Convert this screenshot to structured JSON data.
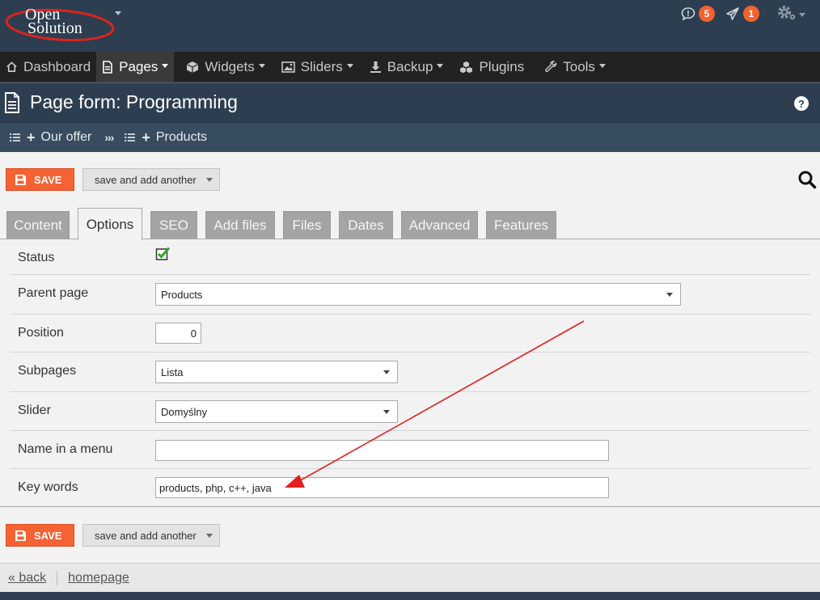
{
  "brand": {
    "logo_line1": "Open",
    "logo_line2": "Solution"
  },
  "header": {
    "messages_count": "5",
    "alerts_count": "1",
    "accent_color": "#f2622e"
  },
  "nav": {
    "items": [
      {
        "label": "Dashboard",
        "icon": "home-icon"
      },
      {
        "label": "Pages",
        "icon": "page-icon"
      },
      {
        "label": "Widgets",
        "icon": "cube-icon"
      },
      {
        "label": "Sliders",
        "icon": "image-icon"
      },
      {
        "label": "Backup",
        "icon": "download-icon"
      },
      {
        "label": "Plugins",
        "icon": "cubes-icon"
      },
      {
        "label": "Tools",
        "icon": "wrench-icon"
      }
    ]
  },
  "title": {
    "text": "Page form: Programming",
    "help": "?"
  },
  "breadcrumb": {
    "items": [
      "Our offer",
      "Products"
    ],
    "separator": "›››"
  },
  "toolbar": {
    "save_label": "SAVE",
    "save_another_label": "save and add another"
  },
  "tabs": [
    "Content",
    "Options",
    "SEO",
    "Add files",
    "Files",
    "Dates",
    "Advanced",
    "Features"
  ],
  "active_tab": "Options",
  "form": {
    "status_label": "Status",
    "status_checked": true,
    "parent_label": "Parent page",
    "parent_value": "Products",
    "position_label": "Position",
    "position_value": "0",
    "subpages_label": "Subpages",
    "subpages_value": "Lista",
    "slider_label": "Slider",
    "slider_value": "Domyślny",
    "menu_name_label": "Name in a menu",
    "menu_name_value": "",
    "keywords_label": "Key words",
    "keywords_value": "products, php, c++, java"
  },
  "footer": {
    "back_label": "« back",
    "home_label": "homepage"
  }
}
